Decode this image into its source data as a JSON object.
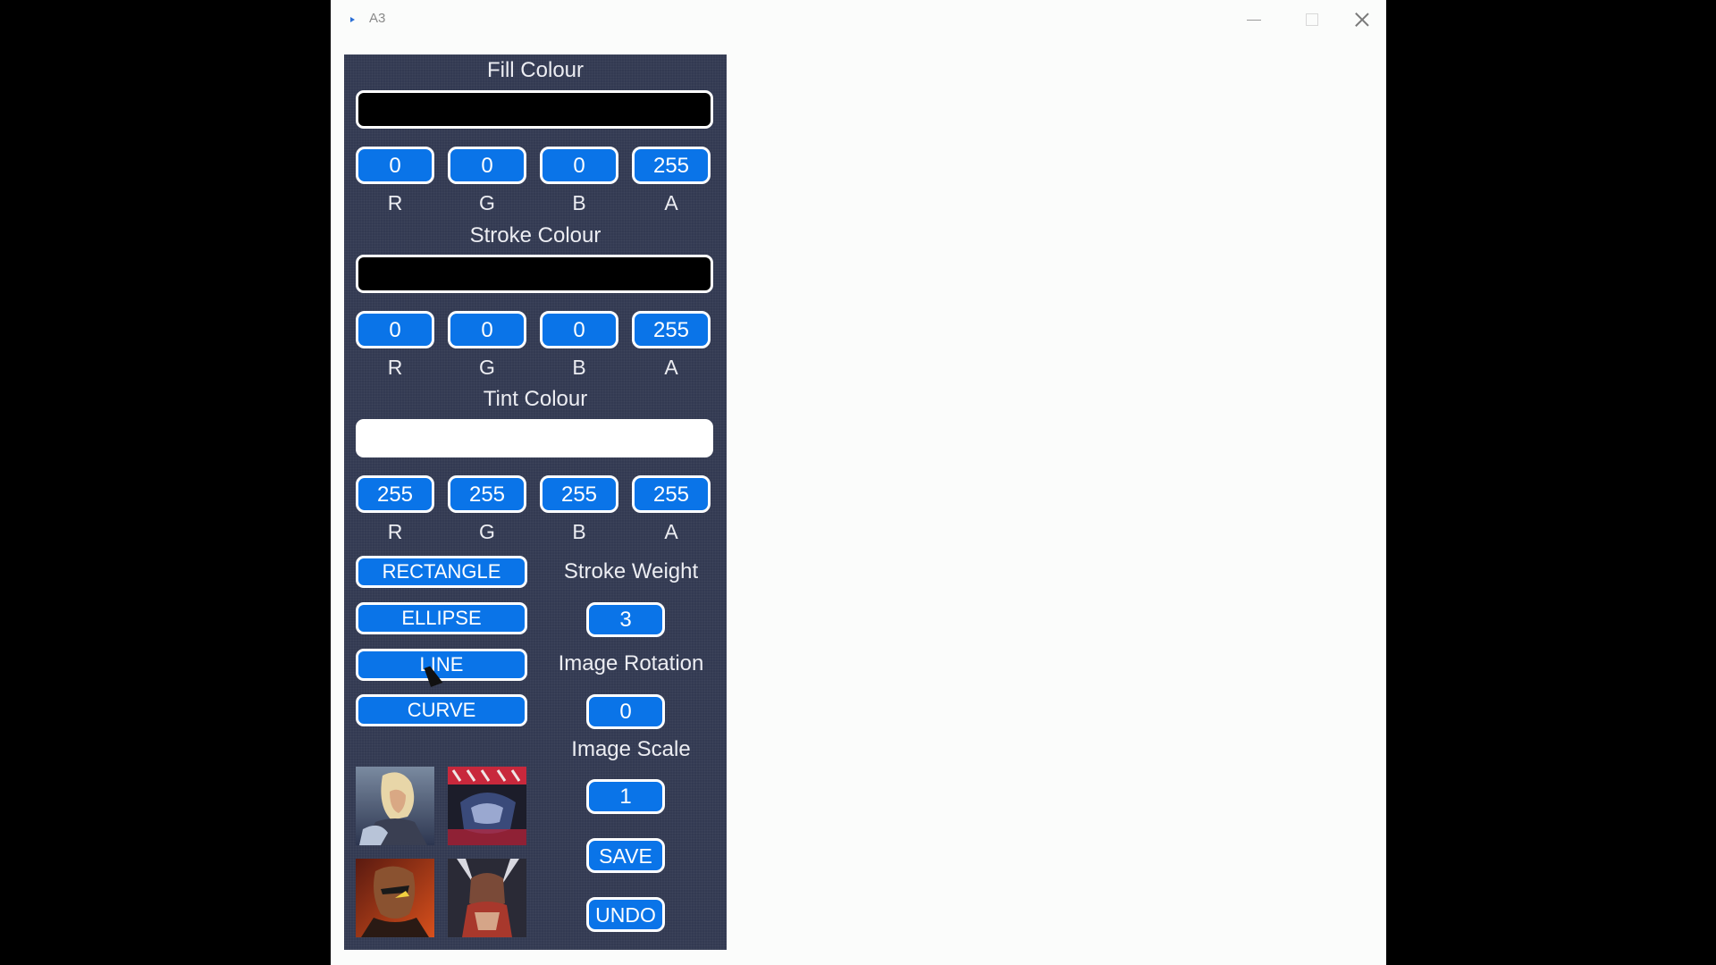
{
  "window": {
    "title": "A3"
  },
  "panel": {
    "fill": {
      "heading": "Fill Colour",
      "swatch_color": "#000000",
      "r": "0",
      "g": "0",
      "b": "0",
      "a": "255"
    },
    "stroke": {
      "heading": "Stroke Colour",
      "swatch_color": "#000000",
      "r": "0",
      "g": "0",
      "b": "0",
      "a": "255"
    },
    "tint": {
      "heading": "Tint Colour",
      "swatch_color": "#ffffff",
      "r": "255",
      "g": "255",
      "b": "255",
      "a": "255"
    },
    "channel_labels": {
      "r": "R",
      "g": "G",
      "b": "B",
      "a": "A"
    },
    "shapes": {
      "rectangle": "RECTANGLE",
      "ellipse": "ELLIPSE",
      "line": "LINE",
      "curve": "CURVE"
    },
    "stroke_weight": {
      "label": "Stroke Weight",
      "value": "3"
    },
    "image_rotation": {
      "label": "Image Rotation",
      "value": "0"
    },
    "image_scale": {
      "label": "Image Scale",
      "value": "1"
    },
    "save_label": "SAVE",
    "undo_label": "UNDO"
  },
  "colors": {
    "panel_bg": "#333a52",
    "button_blue": "#0a74e8",
    "button_border": "#ffffff",
    "canvas_bg": "#fbfcfb"
  }
}
